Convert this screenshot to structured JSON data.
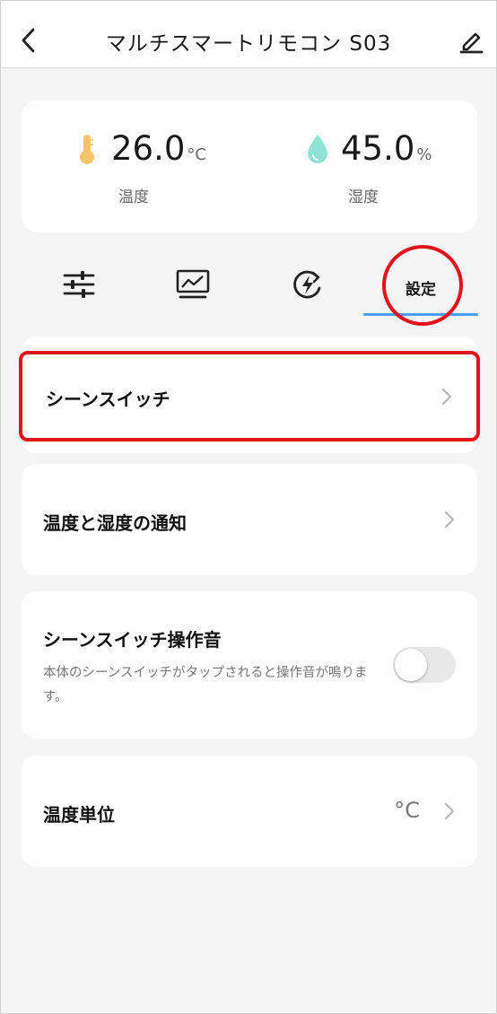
{
  "header": {
    "title": "マルチスマートリモコン S03"
  },
  "sensors": {
    "temperature": {
      "value": "26.0",
      "unit": "°C",
      "label": "温度",
      "icon": "thermometer-icon",
      "color": "#f5c56e"
    },
    "humidity": {
      "value": "45.0",
      "unit": "%",
      "label": "湿度",
      "icon": "water-drop-icon",
      "color": "#8ee3d2"
    }
  },
  "tabs": [
    {
      "icon": "sliders-icon"
    },
    {
      "icon": "chart-monitor-icon"
    },
    {
      "icon": "power-refresh-icon"
    },
    {
      "label": "設定",
      "selected": true
    }
  ],
  "settings": {
    "scene_switch": {
      "label": "シーンスイッチ"
    },
    "notification": {
      "label": "温度と湿度の通知"
    },
    "sound": {
      "label": "シーンスイッチ操作音",
      "description": "本体のシーンスイッチがタップされると操作音が鳴ります。",
      "enabled": false
    },
    "temp_unit": {
      "label": "温度単位",
      "value": "°C"
    }
  },
  "colors": {
    "accent": "#4a9ff5",
    "highlight": "#e0141c"
  }
}
